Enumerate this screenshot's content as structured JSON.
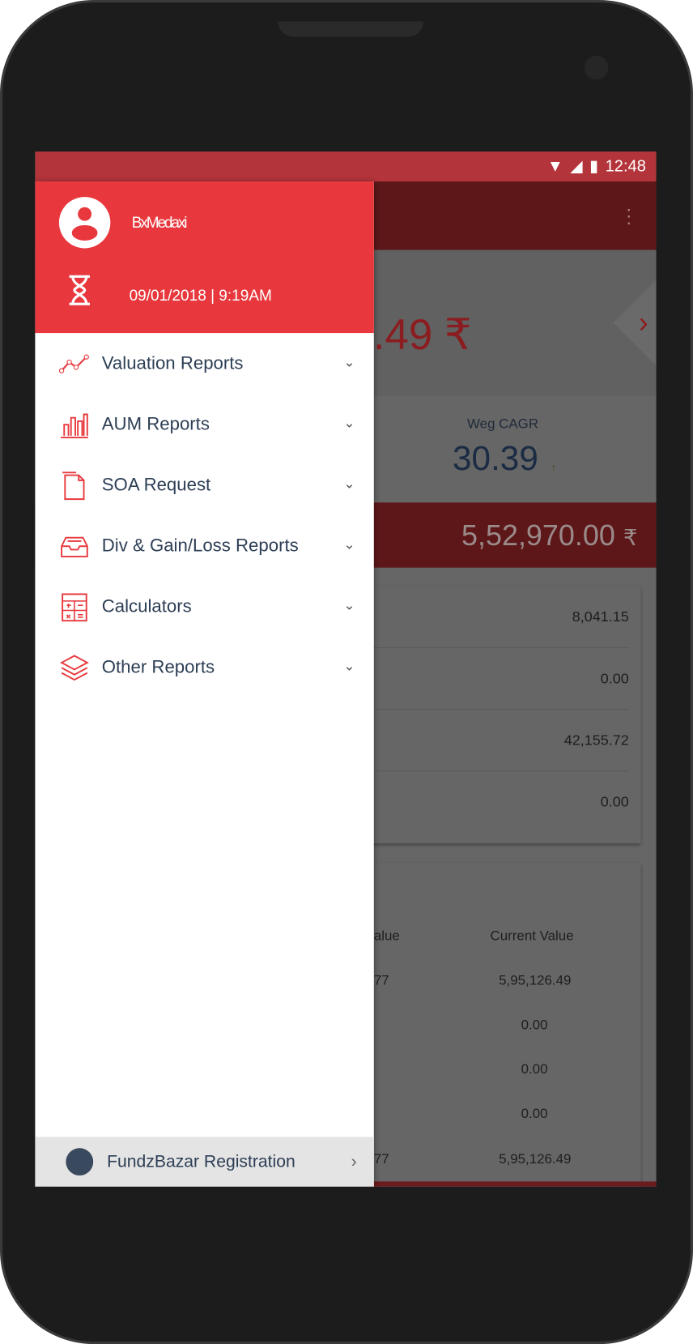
{
  "status_bar": {
    "time": "12:48"
  },
  "drawer": {
    "user_name": "BxMedaxi",
    "last_login": "09/01/2018 | 9:19AM",
    "items": [
      {
        "label": "Valuation Reports",
        "icon": "line-chart-icon"
      },
      {
        "label": "AUM Reports",
        "icon": "bar-chart-icon"
      },
      {
        "label": "SOA Request",
        "icon": "document-icon"
      },
      {
        "label": "Div & Gain/Loss Reports",
        "icon": "inbox-tray-icon"
      },
      {
        "label": "Calculators",
        "icon": "calculator-icon"
      },
      {
        "label": "Other Reports",
        "icon": "layers-icon"
      }
    ],
    "footer": {
      "label": "FundzBazar Registration"
    }
  },
  "background": {
    "total_value_partial": ".49 ₹",
    "cagr_label": "Weg CAGR",
    "cagr_value": "30.39",
    "cagr_arrow": "↑",
    "invested_value": "5,52,970.00",
    "currency": "₹",
    "summary_rows": [
      "8,041.15",
      "0.00",
      "42,155.72",
      "0.00"
    ],
    "table": {
      "col1_header_partial": "alue",
      "col2_header": "Current Value",
      "rows": [
        {
          "c1": "77",
          "c2": "5,95,126.49"
        },
        {
          "c1": "",
          "c2": "0.00"
        },
        {
          "c1": "",
          "c2": "0.00"
        },
        {
          "c1": "",
          "c2": "0.00"
        },
        {
          "c1": "77",
          "c2": "5,95,126.49"
        }
      ]
    }
  },
  "colors": {
    "accent": "#e8383d",
    "dark_red": "#5e1719",
    "text": "#2d3e55"
  }
}
